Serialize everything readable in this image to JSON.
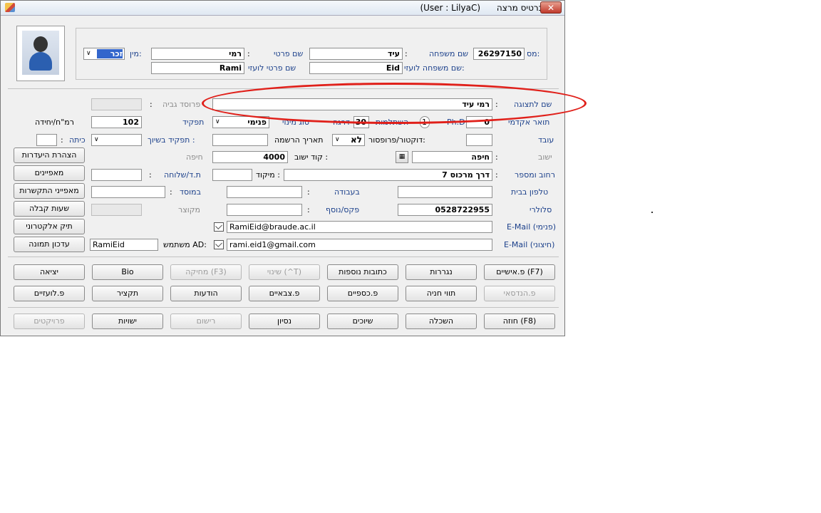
{
  "window": {
    "title": "כרטיס מרצה",
    "user": "(User : LilyaC)",
    "close": "✕"
  },
  "top": {
    "ms_label": "מס:",
    "ms_value": "26297150",
    "family_label": "שם משפחה",
    "family_value": "עיד",
    "first_label": "שם פרטי",
    "first_value": "רמי",
    "gender_label": "מין:",
    "gender_value": "זכר",
    "family_en_label": "שם משפחה לועזי:",
    "family_en_value": "Eid",
    "first_en_label": "שם פרטי לועזי",
    "first_en_value": "Rami"
  },
  "form": {
    "display_label": "שם לתצוגה",
    "display_value": "רמי עיד",
    "height_label": "פרוסד גביה",
    "academic_label": "תואר אקדמי",
    "academic_value": "0",
    "phd": "Ph.D",
    "promotion_label": "השתלמות",
    "promotion_value": "1",
    "degree_label": "דרגה",
    "degree_value": "30",
    "employment_label": "סוג מינוי",
    "employment_value": "פנימי",
    "role_label": "תפקיד",
    "role_value": "102",
    "rank_label": "רמ\"ח/יחידה",
    "worker_label": "עובד",
    "doctor_label": "דוקטור/פרופסור:",
    "doctor_value": "לא",
    "reg_date_label": "תאריך הרשמה",
    "role_assign_label": "תפקיד בשיוך :",
    "class_label": "כיתה",
    "city_label": "ישוב",
    "city_value": "חיפה",
    "zip_label": "קוד ישוב :",
    "zip_value": "4000",
    "city2": "חיפה",
    "street_label": "רחוב ומספר",
    "street_value": "דרך מרכוס 7",
    "zipcode_label": "מיקוד :",
    "pobox_label": "ת.ד/שלוחה",
    "home_phone_label": "טלפון בבית",
    "work_label": "בעבודה",
    "inst_label": "במוסד",
    "mobile_label": "סלולרי",
    "mobile_value": "0528722955",
    "fax_label": "פקס/נוסף",
    "short_label": "מקוצר",
    "email_int_label": "E-Mail (פנימי)",
    "email_int_value": "RamiEid@braude.ac.il",
    "email_ext_label": "E-Mail (חיצוני)",
    "email_ext_value": "rami.eid1@gmail.com",
    "ad_label": "משתמש AD:",
    "ad_value": "RamiEid"
  },
  "side_buttons": [
    "הצהרת היעדרות",
    "מאפיינים",
    "מאפייני התקשרות",
    "שעות קבלה",
    "תיק אלקטרוני",
    "עדכון תמונה"
  ],
  "row1": [
    "פ.אישיים (F7)",
    "נגררות",
    "כתובות נוספות",
    "שינוי (^T)",
    "מחיקה (F3)",
    "Bio",
    "יציאה"
  ],
  "row2": [
    "פ.הנדסאי",
    "תווי חניה",
    "פ.כספיים",
    "פ.צבאיים",
    "הודעות",
    "תקציר",
    "פ.לועזיים"
  ],
  "row3": [
    "חוזה (F8)",
    "השכלה",
    "שיוכים",
    "נסיון",
    "רישום",
    "ישויות",
    "פרויקטים"
  ],
  "colors": {
    "annotation": "#e0201a",
    "label_blue": "#1a3f8a"
  }
}
